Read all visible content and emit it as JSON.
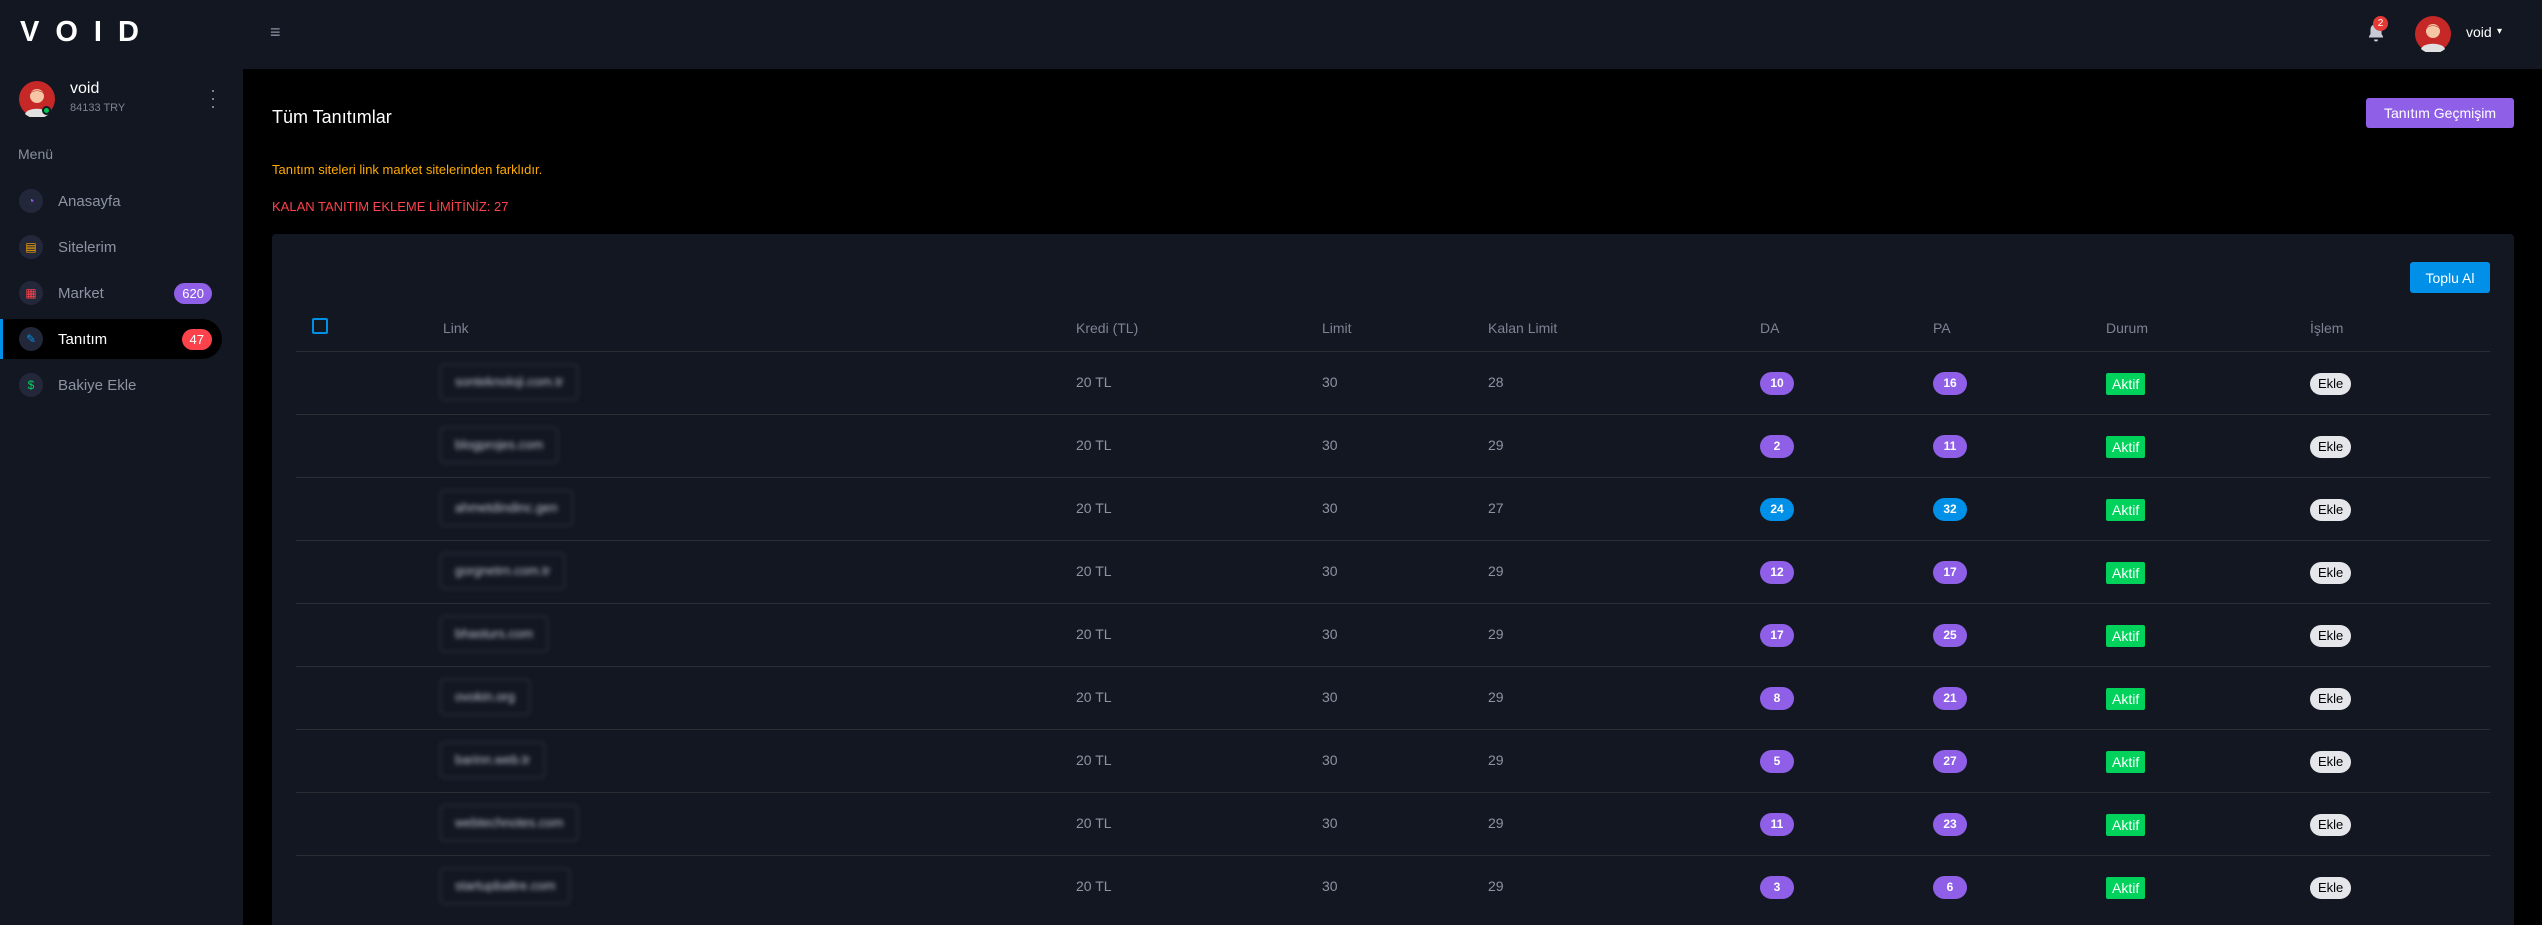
{
  "app": {
    "logo": "VOID"
  },
  "topbar": {
    "notification_count": "2",
    "username": "void"
  },
  "sidebar": {
    "user_name": "void",
    "balance": "84133 TRY",
    "menu_label": "Menü",
    "items": [
      {
        "label": "Anasayfa",
        "icon": "speedometer-icon",
        "badge": "",
        "color": "#8f5fe8"
      },
      {
        "label": "Sitelerim",
        "icon": "laptop-icon",
        "badge": "",
        "color": "#ffab00"
      },
      {
        "label": "Market",
        "icon": "grid-icon",
        "badge": "620",
        "color": "#fc424a"
      },
      {
        "label": "Tanıtım",
        "icon": "pencil-icon",
        "badge": "47",
        "color": "#0090e7",
        "active": true
      },
      {
        "label": "Bakiye Ekle",
        "icon": "dollar-icon",
        "badge": "",
        "color": "#00d25b"
      }
    ]
  },
  "main": {
    "title": "Tüm Tanıtımlar",
    "history_button": "Tanıtım Geçmişim",
    "warning": "Tanıtım siteleri link market sitelerinden farklıdır.",
    "limit_text": "KALAN TANITIM EKLEME LİMİTİNİZ: 27",
    "bulk_button": "Toplu Al"
  },
  "table": {
    "headers": [
      "Link",
      "Kredi (TL)",
      "Limit",
      "Kalan Limit",
      "DA",
      "PA",
      "Durum",
      "İşlem"
    ],
    "rows": [
      {
        "link": "sonteknoloji.com.tr",
        "kredi": "20 TL",
        "limit": "30",
        "kalan": "28",
        "da": "10",
        "pa": "16",
        "da_color": "purple",
        "pa_color": "purple",
        "durum": "Aktif",
        "islem": "Ekle"
      },
      {
        "link": "blogprojes.com",
        "kredi": "20 TL",
        "limit": "30",
        "kalan": "29",
        "da": "2",
        "pa": "11",
        "da_color": "purple",
        "pa_color": "purple",
        "durum": "Aktif",
        "islem": "Ekle"
      },
      {
        "link": "ahmetdindinc.gen",
        "kredi": "20 TL",
        "limit": "30",
        "kalan": "27",
        "da": "24",
        "pa": "32",
        "da_color": "blue",
        "pa_color": "blue",
        "durum": "Aktif",
        "islem": "Ekle"
      },
      {
        "link": "gorgnetrn.com.tr",
        "kredi": "20 TL",
        "limit": "30",
        "kalan": "29",
        "da": "12",
        "pa": "17",
        "da_color": "purple",
        "pa_color": "purple",
        "durum": "Aktif",
        "islem": "Ekle"
      },
      {
        "link": "bhasturs.com",
        "kredi": "20 TL",
        "limit": "30",
        "kalan": "29",
        "da": "17",
        "pa": "25",
        "da_color": "purple",
        "pa_color": "purple",
        "durum": "Aktif",
        "islem": "Ekle"
      },
      {
        "link": "ovokin.org",
        "kredi": "20 TL",
        "limit": "30",
        "kalan": "29",
        "da": "8",
        "pa": "21",
        "da_color": "purple",
        "pa_color": "purple",
        "durum": "Aktif",
        "islem": "Ekle"
      },
      {
        "link": "barinn.web.tr",
        "kredi": "20 TL",
        "limit": "30",
        "kalan": "29",
        "da": "5",
        "pa": "27",
        "da_color": "purple",
        "pa_color": "purple",
        "durum": "Aktif",
        "islem": "Ekle"
      },
      {
        "link": "webtechnotes.com",
        "kredi": "20 TL",
        "limit": "30",
        "kalan": "29",
        "da": "11",
        "pa": "23",
        "da_color": "purple",
        "pa_color": "purple",
        "durum": "Aktif",
        "islem": "Ekle"
      },
      {
        "link": "startupbaltre.com",
        "kredi": "20 TL",
        "limit": "30",
        "kalan": "29",
        "da": "3",
        "pa": "6",
        "da_color": "purple",
        "pa_color": "purple",
        "durum": "Aktif",
        "islem": "Ekle"
      }
    ]
  }
}
